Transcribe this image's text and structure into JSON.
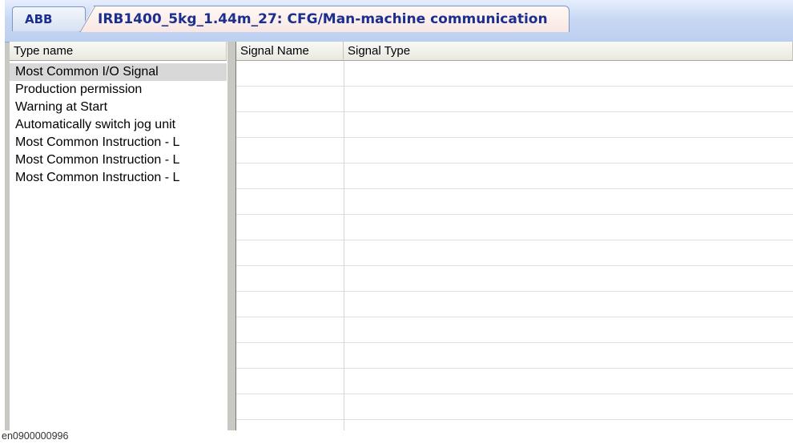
{
  "tabs": {
    "inactive_label": "ABB",
    "active_label": "IRB1400_5kg_1.44m_27: CFG/Man-machine communication"
  },
  "left_panel": {
    "header": "Type name",
    "items": [
      {
        "label": "Most Common I/O Signal",
        "selected": true
      },
      {
        "label": "Production permission",
        "selected": false
      },
      {
        "label": "Warning at Start",
        "selected": false
      },
      {
        "label": "Automatically switch jog unit",
        "selected": false
      },
      {
        "label": "Most Common Instruction - L",
        "selected": false
      },
      {
        "label": "Most Common Instruction - L",
        "selected": false
      },
      {
        "label": "Most Common Instruction - L",
        "selected": false
      }
    ]
  },
  "right_panel": {
    "columns": [
      "Signal Name",
      "Signal Type"
    ],
    "rows": [
      [
        "",
        ""
      ],
      [
        "",
        ""
      ],
      [
        "",
        ""
      ],
      [
        "",
        ""
      ],
      [
        "",
        ""
      ],
      [
        "",
        ""
      ],
      [
        "",
        ""
      ],
      [
        "",
        ""
      ],
      [
        "",
        ""
      ],
      [
        "",
        ""
      ],
      [
        "",
        ""
      ],
      [
        "",
        ""
      ],
      [
        "",
        ""
      ],
      [
        "",
        ""
      ],
      [
        "",
        ""
      ]
    ]
  },
  "caption": "en0900000996"
}
